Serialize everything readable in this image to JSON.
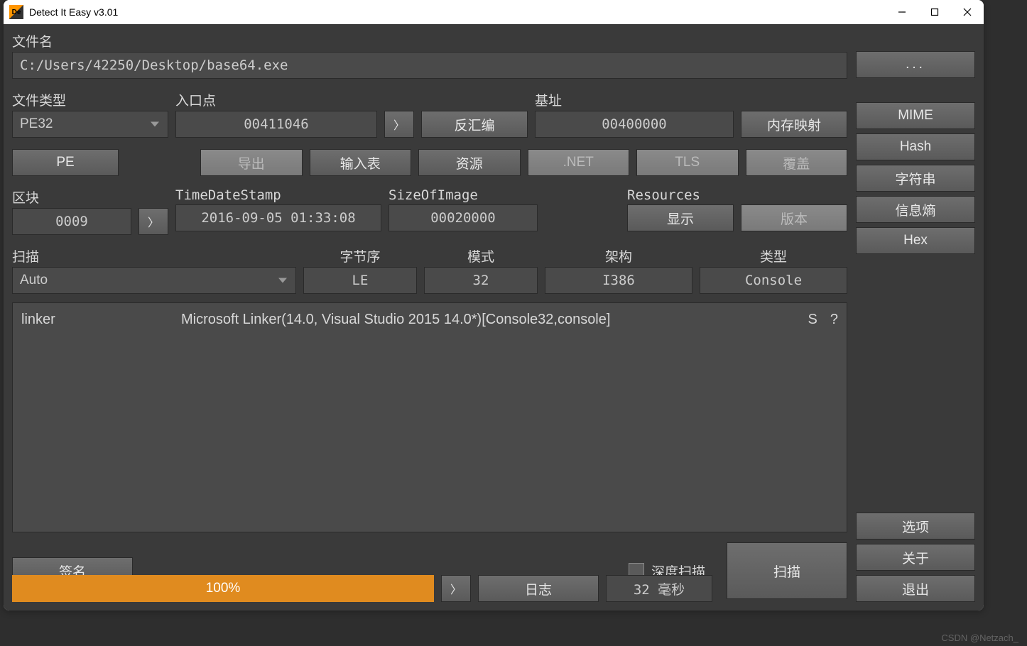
{
  "titlebar": {
    "title": "Detect It Easy v3.01"
  },
  "labels": {
    "filename": "文件名",
    "filetype": "文件类型",
    "entrypoint": "入口点",
    "baseaddr": "基址",
    "sections": "区块",
    "timedatestamp": "TimeDateStamp",
    "sizeofimage": "SizeOfImage",
    "resources": "Resources",
    "scan": "扫描",
    "endianness": "字节序",
    "mode": "模式",
    "arch": "架构",
    "type": "类型"
  },
  "values": {
    "filepath": "C:/Users/42250/Desktop/base64.exe",
    "filetype": "PE32",
    "entrypoint": "00411046",
    "baseaddr": "00400000",
    "sections": "0009",
    "timedatestamp": "2016-09-05 01:33:08",
    "sizeofimage": "00020000",
    "scan_mode": "Auto",
    "endianness": "LE",
    "mode": "32",
    "arch": "I386",
    "type": "Console",
    "progress": "100%",
    "elapsed": "32 毫秒"
  },
  "buttons": {
    "browse": "...",
    "disasm": "反汇编",
    "memmap": "内存映射",
    "pe": "PE",
    "export": "导出",
    "import": "输入表",
    "resource": "资源",
    "dotnet": ".NET",
    "tls": "TLS",
    "overlay": "覆盖",
    "show": "显示",
    "version": "版本",
    "signature": "签名",
    "log": "日志",
    "scan": "扫描",
    "deep_scan": "深度扫描",
    "arrow": "〉"
  },
  "side": {
    "mime": "MIME",
    "hash": "Hash",
    "strings": "字符串",
    "entropy": "信息熵",
    "hex": "Hex",
    "options": "选项",
    "about": "关于",
    "exit": "退出"
  },
  "results": [
    {
      "type": "linker",
      "name": "Microsoft Linker(14.0, Visual Studio 2015 14.0*)[Console32,console]",
      "s": "S",
      "q": "?"
    }
  ],
  "watermark": "CSDN @Netzach_"
}
